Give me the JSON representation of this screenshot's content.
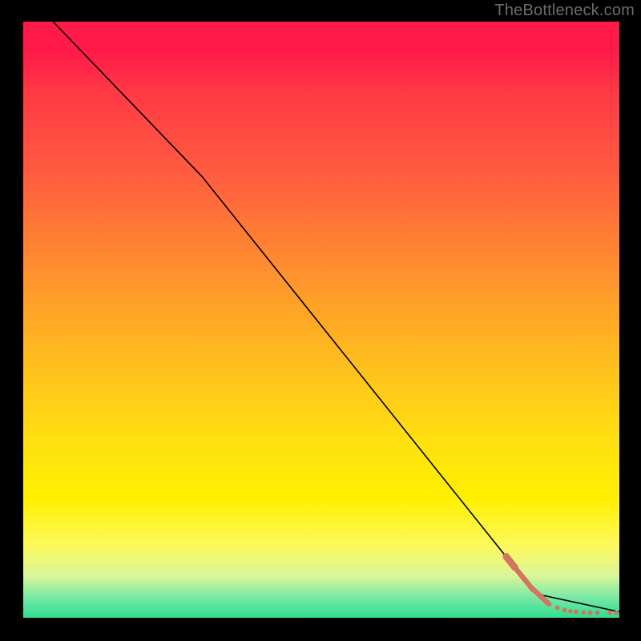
{
  "watermark": "TheBottleneck.com",
  "chart_data": {
    "type": "line",
    "title": "",
    "xlabel": "",
    "ylabel": "",
    "xlim": [
      0,
      100
    ],
    "ylim": [
      0,
      100
    ],
    "grid": false,
    "line_points": [
      {
        "x": 5,
        "y": 100
      },
      {
        "x": 30,
        "y": 74
      },
      {
        "x": 86,
        "y": 4
      },
      {
        "x": 100,
        "y": 1
      }
    ],
    "marker_segments": [
      {
        "x0": 81.0,
        "y0": 10.3,
        "x1": 82.5,
        "y1": 8.4,
        "radius": 4.3
      },
      {
        "x0": 82.5,
        "y0": 8.4,
        "x1": 85.5,
        "y1": 4.7,
        "radius": 3.2
      },
      {
        "x0": 85.3,
        "y0": 5.0,
        "x1": 88.2,
        "y1": 2.3,
        "radius": 3.2
      }
    ],
    "marker_points": [
      {
        "x": 88.2,
        "y": 2.3,
        "r": 3.2
      },
      {
        "x": 89.6,
        "y": 1.7,
        "r": 2.8
      },
      {
        "x": 90.8,
        "y": 1.3,
        "r": 2.8
      },
      {
        "x": 91.8,
        "y": 1.1,
        "r": 2.8
      },
      {
        "x": 92.7,
        "y": 1.0,
        "r": 2.8
      },
      {
        "x": 94.0,
        "y": 0.9,
        "r": 2.8
      },
      {
        "x": 95.1,
        "y": 0.85,
        "r": 2.8
      },
      {
        "x": 96.3,
        "y": 0.85,
        "r": 2.8
      },
      {
        "x": 98.4,
        "y": 0.85,
        "r": 2.8
      },
      {
        "x": 99.5,
        "y": 0.85,
        "r": 2.8
      }
    ],
    "colors": {
      "gradient_top": "#ff1a4a",
      "gradient_mid": "#ffe010",
      "gradient_bottom": "#30dd8e",
      "curve": "#000000",
      "markers": "#d27461",
      "frame": "#000000"
    }
  }
}
